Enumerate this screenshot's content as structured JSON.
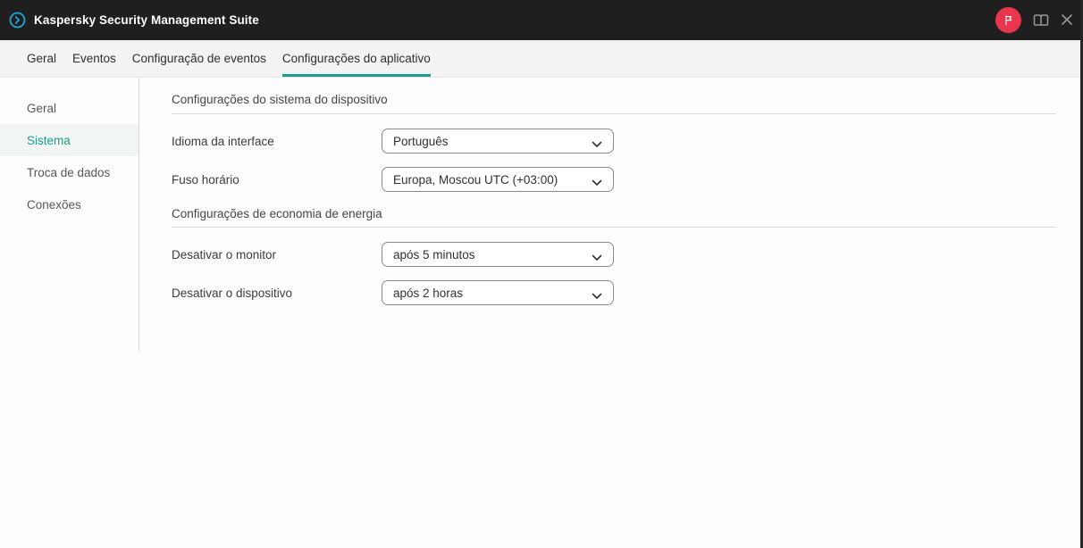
{
  "header": {
    "title": "Kaspersky Security Management Suite",
    "logo_icon": "kaspersky-logo-icon",
    "actions": [
      {
        "name": "flag-notification-badge",
        "icon": "flag-icon",
        "color": "#e8364f"
      },
      {
        "name": "documentation-button",
        "icon": "book-icon"
      },
      {
        "name": "close-button",
        "icon": "close-icon"
      }
    ]
  },
  "tabs": [
    {
      "label": "Geral",
      "active": false
    },
    {
      "label": "Eventos",
      "active": false
    },
    {
      "label": "Configuração de eventos",
      "active": false
    },
    {
      "label": "Configurações do aplicativo",
      "active": true
    }
  ],
  "sidebar": {
    "items": [
      {
        "label": "Geral",
        "active": false
      },
      {
        "label": "Sistema",
        "active": true
      },
      {
        "label": "Troca de dados",
        "active": false
      },
      {
        "label": "Conexões",
        "active": false
      }
    ]
  },
  "content": {
    "sections": [
      {
        "title": "Configurações do sistema do dispositivo",
        "rows": [
          {
            "label": "Idioma da interface",
            "value": "Português"
          },
          {
            "label": "Fuso horário",
            "value": "Europa, Moscou UTC (+03:00)"
          }
        ]
      },
      {
        "title": "Configurações de economia de energia",
        "rows": [
          {
            "label": "Desativar o monitor",
            "value": "após 5 minutos"
          },
          {
            "label": "Desativar o dispositivo",
            "value": "após 2 horas"
          }
        ]
      }
    ]
  },
  "colors": {
    "accent_teal": "#1d9e8c",
    "badge_red": "#e8364f",
    "logo_blue": "#1ba6e0",
    "header_bg": "#1f1f1f"
  }
}
